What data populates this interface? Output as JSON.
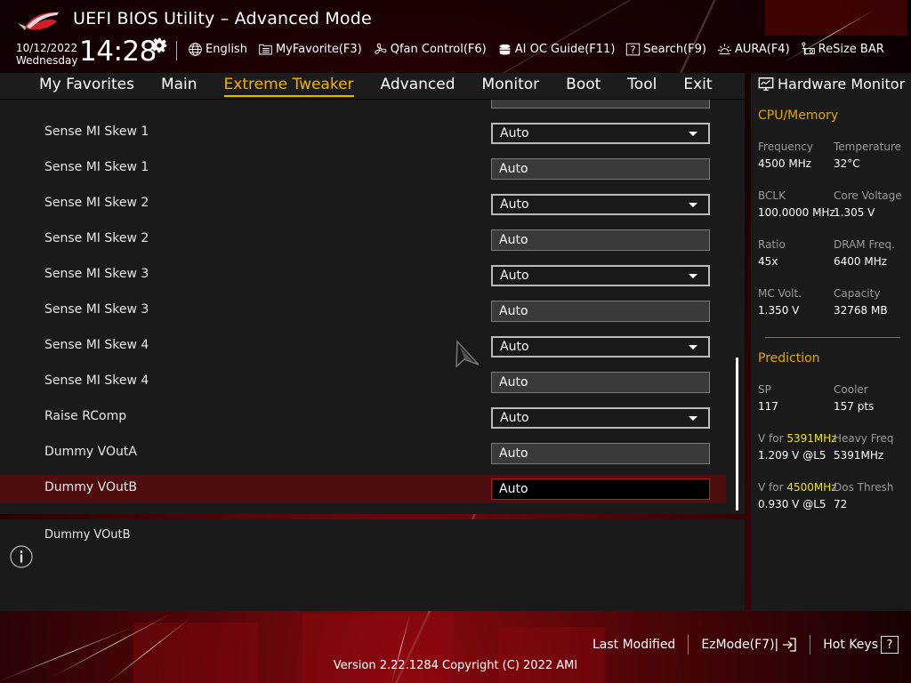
{
  "header": {
    "title": "UEFI BIOS Utility – Advanced Mode",
    "date": "10/12/2022",
    "weekday": "Wednesday",
    "time": "14:28",
    "toolbar": [
      {
        "label": "English",
        "icon": "globe-icon"
      },
      {
        "label": "MyFavorite(F3)",
        "icon": "favorite-list-icon"
      },
      {
        "label": "Qfan Control(F6)",
        "icon": "fan-icon"
      },
      {
        "label": "AI OC Guide(F11)",
        "icon": "ai-chip-icon"
      },
      {
        "label": "Search(F9)",
        "icon": "question-box-icon"
      },
      {
        "label": "AURA(F4)",
        "icon": "aura-light-icon"
      },
      {
        "label": "ReSize BAR",
        "icon": "resize-bar-icon"
      }
    ]
  },
  "nav": {
    "tabs": [
      {
        "label": "My Favorites",
        "active": false
      },
      {
        "label": "Main",
        "active": false
      },
      {
        "label": "Extreme Tweaker",
        "active": true
      },
      {
        "label": "Advanced",
        "active": false
      },
      {
        "label": "Monitor",
        "active": false
      },
      {
        "label": "Boot",
        "active": false
      },
      {
        "label": "Tool",
        "active": false
      },
      {
        "label": "Exit",
        "active": false
      }
    ]
  },
  "settings": [
    {
      "label": "Sense MI Skew 1",
      "value": "Auto",
      "type": "dropdown"
    },
    {
      "label": "Sense MI Skew 1",
      "value": "Auto",
      "type": "field"
    },
    {
      "label": "Sense MI Skew 2",
      "value": "Auto",
      "type": "dropdown"
    },
    {
      "label": "Sense MI Skew 2",
      "value": "Auto",
      "type": "field"
    },
    {
      "label": "Sense MI Skew 3",
      "value": "Auto",
      "type": "dropdown"
    },
    {
      "label": "Sense MI Skew 3",
      "value": "Auto",
      "type": "field"
    },
    {
      "label": "Sense MI Skew 4",
      "value": "Auto",
      "type": "dropdown"
    },
    {
      "label": "Sense MI Skew 4",
      "value": "Auto",
      "type": "field"
    },
    {
      "label": "Raise RComp",
      "value": "Auto",
      "type": "dropdown"
    },
    {
      "label": "Dummy VOutA",
      "value": "Auto",
      "type": "field"
    },
    {
      "label": "Dummy VOutB",
      "value": "Auto",
      "type": "field",
      "selected": true
    }
  ],
  "info": {
    "text": "Dummy VOutB"
  },
  "hardware_monitor": {
    "title": "Hardware Monitor",
    "cpu_memory": {
      "heading": "CPU/Memory",
      "items": [
        {
          "key": "Frequency",
          "value": "4500 MHz"
        },
        {
          "key": "Temperature",
          "value": "32°C"
        },
        {
          "key": "BCLK",
          "value": "100.0000 MHz"
        },
        {
          "key": "Core Voltage",
          "value": "1.305 V"
        },
        {
          "key": "Ratio",
          "value": "45x"
        },
        {
          "key": "DRAM Freq.",
          "value": "6400 MHz"
        },
        {
          "key": "MC Volt.",
          "value": "1.350 V"
        },
        {
          "key": "Capacity",
          "value": "32768 MB"
        }
      ]
    },
    "prediction": {
      "heading": "Prediction",
      "sp_key": "SP",
      "sp_value": "117",
      "cooler_key": "Cooler",
      "cooler_value": "157 pts",
      "v1_prefix": "V for ",
      "v1_freq": "5391MHz",
      "v1_value": "1.209 V @L5",
      "heavy_key": "Heavy Freq",
      "heavy_value": "5391MHz",
      "v2_prefix": "V for ",
      "v2_freq": "4500MHz",
      "v2_value": "0.930 V @L5",
      "dos_key": "Dos Thresh",
      "dos_value": "72"
    }
  },
  "footer": {
    "last_modified": "Last Modified",
    "ezmode": "EzMode(F7)|",
    "hotkeys": "Hot Keys",
    "hotkeys_symbol": "?",
    "version": "Version 2.22.1284 Copyright (C) 2022 AMI"
  },
  "colors": {
    "accent": "#f0b400",
    "selected_row": "#4e0e10",
    "highlight_freq": "#f2e21a"
  }
}
